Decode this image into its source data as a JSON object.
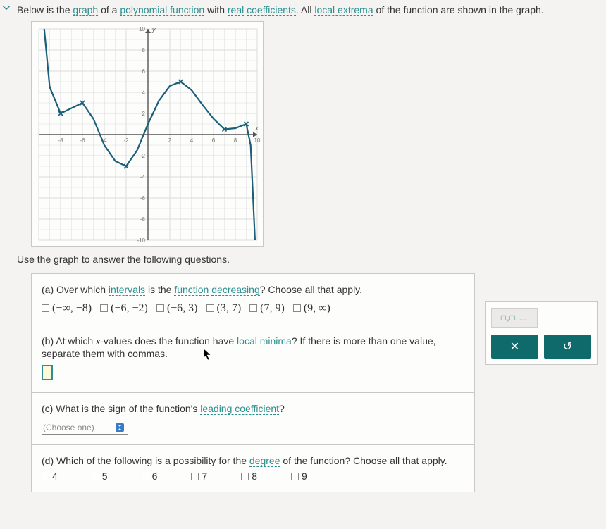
{
  "intro": {
    "prefix": "Below is the ",
    "t1": "graph",
    "mid1": " of a ",
    "t2": "polynomial function",
    "mid2": " with ",
    "t3": "real",
    "space": " ",
    "t4": "coefficients",
    "mid3": ". All ",
    "t5": "local extrema",
    "suffix": " of the function are shown in the graph."
  },
  "prompt2": "Use the graph to answer the following questions.",
  "a": {
    "q1": "(a) Over which ",
    "t1": "intervals",
    "q2": " is the ",
    "t2": "function",
    "q3": " ",
    "t3": "decreasing",
    "q4": "? Choose all that apply.",
    "opts": [
      "(−∞, −8)",
      "(−6, −2)",
      "(−6, 3)",
      "(3, 7)",
      "(7, 9)",
      "(9, ∞)"
    ]
  },
  "b": {
    "q1": "(b) At which ",
    "var": "x",
    "q2": "-values does the function have ",
    "t1": "local minima",
    "q3": "? If there is more than one value, separate them with commas."
  },
  "c": {
    "q1": "(c) What is the sign of the function's ",
    "t1": "leading coefficient",
    "q2": "?",
    "dropdown": "(Choose one)"
  },
  "d": {
    "q1": "(d) Which of the following is a possibility for the ",
    "t1": "degree",
    "q2": " of the function? Choose all that apply.",
    "opts": [
      "4",
      "5",
      "6",
      "7",
      "8",
      "9"
    ]
  },
  "side": {
    "tab": "□,□,…",
    "x": "✕",
    "reset": "↺"
  },
  "chart_data": {
    "type": "line",
    "title": "",
    "xlabel": "x",
    "ylabel": "y",
    "xlim": [
      -10,
      10
    ],
    "ylim": [
      -10,
      10
    ],
    "x": [
      -9.5,
      -9,
      -8,
      -7,
      -6,
      -5,
      -4,
      -3,
      -2,
      -1,
      0,
      1,
      2,
      3,
      4,
      5,
      6,
      7,
      8,
      9,
      9.4,
      9.8
    ],
    "y": [
      10,
      4.5,
      2,
      2.5,
      3,
      1.5,
      -1,
      -2.5,
      -3,
      -1.5,
      1,
      3.2,
      4.6,
      5,
      4.2,
      2.8,
      1.5,
      0.5,
      0.6,
      1,
      -1,
      -10
    ],
    "local_extrema_marks": [
      {
        "x": -8,
        "y": 2
      },
      {
        "x": -6,
        "y": 3
      },
      {
        "x": -2,
        "y": -3
      },
      {
        "x": 3,
        "y": 5
      },
      {
        "x": 7,
        "y": 0.5
      },
      {
        "x": 9,
        "y": 1
      }
    ],
    "axis_ticks_x": [
      -8,
      -6,
      -4,
      -2,
      2,
      4,
      6,
      8,
      10
    ],
    "axis_ticks_y": [
      -10,
      -8,
      -6,
      -4,
      -2,
      2,
      4,
      6,
      8,
      10
    ]
  }
}
